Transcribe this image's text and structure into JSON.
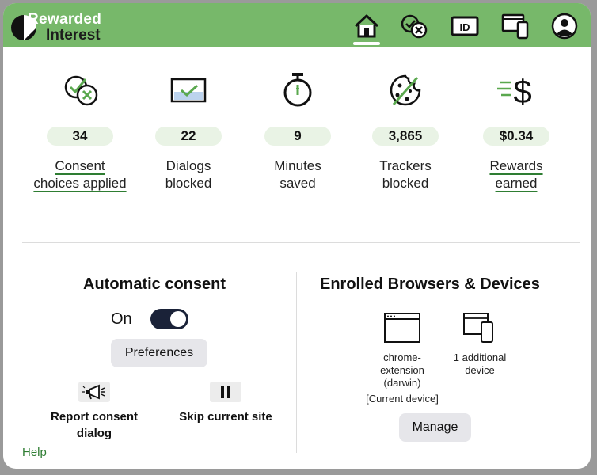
{
  "brand": {
    "line1": "Rewarded",
    "line2": "Interest"
  },
  "nav": {
    "items": [
      {
        "icon": "home-icon"
      },
      {
        "icon": "consent-check-x-icon"
      },
      {
        "icon": "id-card-icon"
      },
      {
        "icon": "devices-icon"
      },
      {
        "icon": "account-icon"
      }
    ]
  },
  "stats": [
    {
      "icon": "consent-check-x-icon",
      "value": "34",
      "label_line1": "Consent",
      "label_line2": "choices applied"
    },
    {
      "icon": "dialog-blocked-icon",
      "value": "22",
      "label_line1": "Dialogs",
      "label_line2": "blocked"
    },
    {
      "icon": "stopwatch-icon",
      "value": "9",
      "label_line1": "Minutes",
      "label_line2": "saved"
    },
    {
      "icon": "cookie-blocked-icon",
      "value": "3,865",
      "label_line1": "Trackers",
      "label_line2": "blocked"
    },
    {
      "icon": "dollar-icon",
      "value": "$0.34",
      "label_line1": "Rewards",
      "label_line2": "earned"
    }
  ],
  "auto_consent": {
    "title": "Automatic consent",
    "state_label": "On",
    "enabled": true,
    "preferences_label": "Preferences",
    "report_label_line1": "Report consent",
    "report_label_line2": "dialog",
    "skip_label": "Skip current site"
  },
  "enrolled": {
    "title": "Enrolled Browsers & Devices",
    "current": {
      "line1": "chrome-",
      "line2": "extension",
      "line3": "(darwin)",
      "tag": "[Current device]"
    },
    "additional": {
      "line1": "1 additional",
      "line2": "device"
    },
    "manage_label": "Manage"
  },
  "help_label": "Help",
  "colors": {
    "header": "#77b86a",
    "accent": "#2e7d32",
    "pill": "#e9f3e5",
    "toggle": "#1a2238"
  }
}
